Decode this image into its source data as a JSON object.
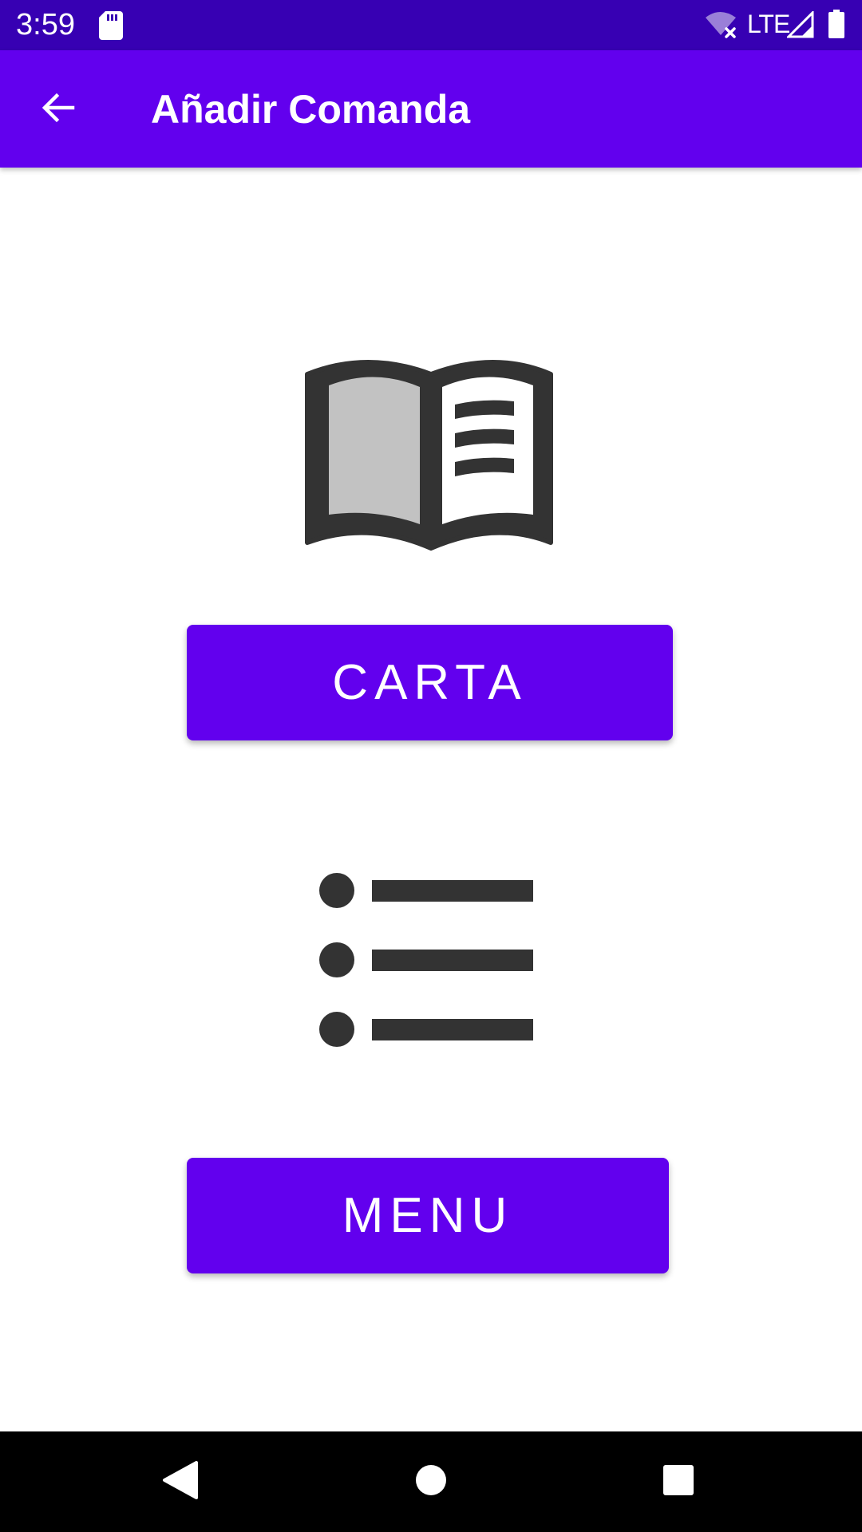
{
  "status_bar": {
    "time": "3:59",
    "network": "LTE",
    "background_color": "#3700b3",
    "icons": [
      "sd-card-icon",
      "wifi-off-icon",
      "signal-icon",
      "battery-icon"
    ]
  },
  "app_bar": {
    "title": "Añadir Comanda",
    "back_icon": "arrow-back-icon",
    "background_color": "#6200ee"
  },
  "main": {
    "carta": {
      "illustration": "open-book-icon",
      "button_label": "CARTA"
    },
    "menu": {
      "illustration": "bullet-list-icon",
      "button_label": "MENU"
    },
    "button_color": "#6200ee",
    "illustration_color": "#333333"
  },
  "nav_bar": {
    "buttons": [
      "nav-back-icon",
      "nav-home-icon",
      "nav-recents-icon"
    ]
  }
}
